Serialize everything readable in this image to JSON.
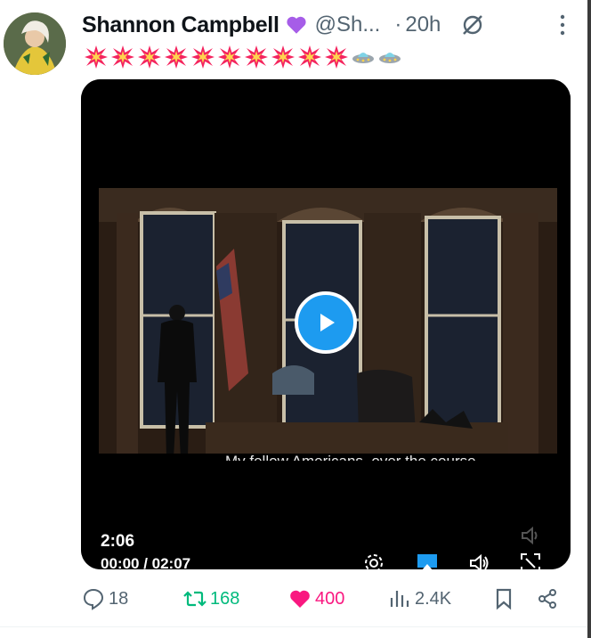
{
  "post": {
    "author_name": "Shannon Campbell",
    "handle": "@Sh...",
    "separator": "·",
    "time": "20h",
    "video": {
      "duration": "2:06",
      "timecode": "00:00 / 02:07",
      "subtitle_fragment": "My fellow Americans, over the course"
    }
  },
  "actions": {
    "replies": "18",
    "reposts": "168",
    "likes": "400",
    "views": "2.4K"
  },
  "colors": {
    "accent": "#1d9bf0",
    "repost": "#00ba7c",
    "like": "#f91880",
    "muted": "#536471"
  },
  "icons": [
    "purple-heart-icon",
    "grok-icon",
    "more-icon",
    "collision-emoji-icon",
    "flying-saucer-emoji-icon",
    "play-icon",
    "settings-icon",
    "airplay-icon",
    "volume-icon",
    "fullscreen-icon",
    "reply-icon",
    "repost-icon",
    "like-icon",
    "views-icon",
    "bookmark-icon",
    "share-icon"
  ]
}
